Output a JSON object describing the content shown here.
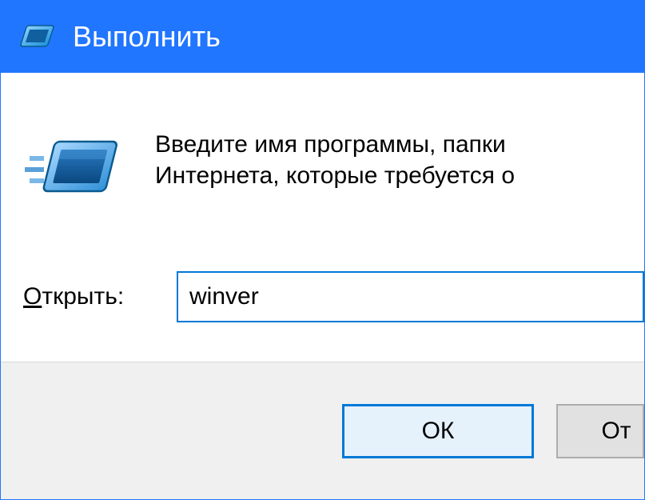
{
  "titlebar": {
    "title": "Выполнить"
  },
  "content": {
    "info_line1": "Введите имя программы, папки",
    "info_line2": "Интернета, которые требуется о",
    "label_prefix": "О",
    "label_rest": "ткрыть:",
    "input_value": "winver"
  },
  "footer": {
    "ok_label": "ОК",
    "cancel_label": "От"
  }
}
